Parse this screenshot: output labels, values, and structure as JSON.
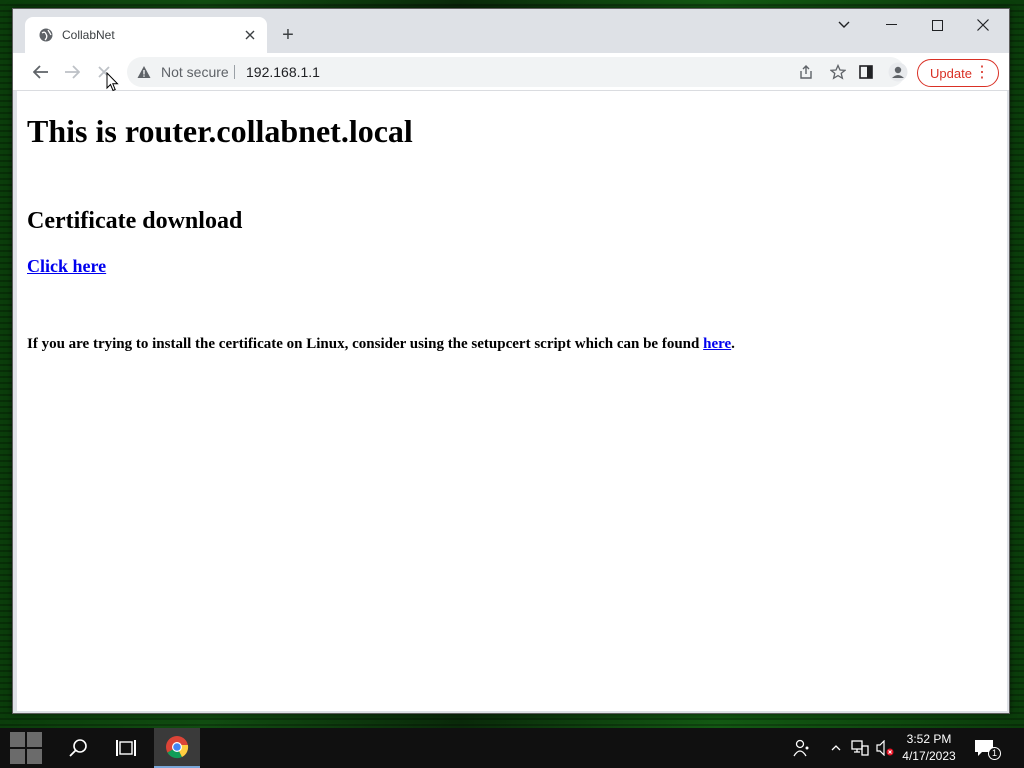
{
  "browser": {
    "tab_title": "CollabNet",
    "new_tab_symbol": "+",
    "omnibox": {
      "security_label": "Not secure",
      "url": "192.168.1.1"
    },
    "update_label": "Update",
    "update_menu_symbol": "⋮",
    "accent_color": "#d93025",
    "icons": [
      "globe-icon",
      "close-icon",
      "plus-icon",
      "chevron-down-icon",
      "minimize-icon",
      "maximize-icon",
      "close-window-icon",
      "back-arrow-icon",
      "forward-arrow-icon",
      "stop-loading-icon",
      "warning-icon",
      "share-icon",
      "bookmark-star-icon",
      "side-panel-icon",
      "profile-icon"
    ]
  },
  "page": {
    "heading": "This is router.collabnet.local",
    "subheading": "Certificate download",
    "download_link": "Click here",
    "note_prefix": "If you are trying to install the certificate on Linux, consider using the setupcert script which can be found ",
    "note_link": "here",
    "note_suffix": ".",
    "link_color": "#0000ee"
  },
  "taskbar": {
    "time": "3:52 PM",
    "date": "4/17/2023",
    "notification_count": "1",
    "icons": [
      "windows-start-icon",
      "search-icon",
      "task-view-icon",
      "chrome-icon",
      "people-icon",
      "chevron-up-icon",
      "network-icon",
      "volume-muted-icon",
      "notification-icon"
    ]
  }
}
